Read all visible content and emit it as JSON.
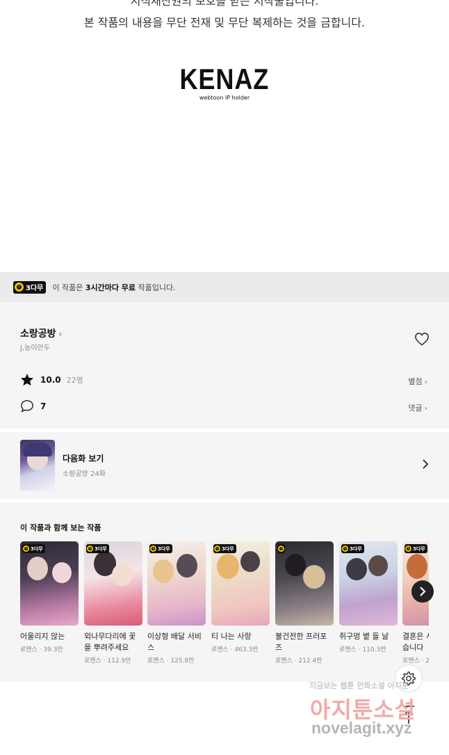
{
  "copyright": {
    "line1": "지식재산권의 보호를 받는 저작물입니다.",
    "line2": "본 작품의 내용을 무단 전재 및 무단 복제하는 것을 금합니다."
  },
  "logo": {
    "mark": "KENAZ",
    "sub": "webtoon IP holder"
  },
  "free_bar": {
    "badge": "3다무",
    "text_prefix": "이 작품은 ",
    "text_bold": "3시간마다 무료",
    "text_suffix": " 작품입니다."
  },
  "work": {
    "title": "소랑공방",
    "authors": "J,능이만두",
    "rating": "10.0",
    "rating_count": "22명",
    "rating_link": "별점",
    "comment_count": "7",
    "comment_link": "댓글"
  },
  "next_episode": {
    "label": "다음화 보기",
    "sub": "소랑공방 24화"
  },
  "recommend": {
    "title": "이 작품과 함께 보는 작품",
    "badge": "3다무",
    "items": [
      {
        "name": "어울리지 않는",
        "meta": "로맨스 · 39.3만",
        "badge": true
      },
      {
        "name": "외나무다리에 꽃을 뿌려주세요",
        "meta": "로맨스 · 112.9만",
        "badge": true
      },
      {
        "name": "이상형 배달 서비스",
        "meta": "로맨스 · 125.8만",
        "badge": true
      },
      {
        "name": "티 나는 사랑",
        "meta": "로맨스 · 463.3만",
        "badge": true
      },
      {
        "name": "불건전한 프러포즈",
        "meta": "로맨스 · 212.4만",
        "badge": false
      },
      {
        "name": "쥐구멍 볕 들 날",
        "meta": "로맨스 · 110.3만",
        "badge": true
      },
      {
        "name": "결혼은 사양하겠습니다",
        "meta": "로맨스 · 2",
        "badge": true
      }
    ]
  },
  "watermark": {
    "line1": "지금보는 웹툰 만화소설 아지툰",
    "line2": "아지툰소설",
    "line3": "novelagit.xyz"
  },
  "colors": {
    "accent_yellow": "#f5c400",
    "badge_black": "#111111",
    "section_bg": "#f5f5f5"
  }
}
